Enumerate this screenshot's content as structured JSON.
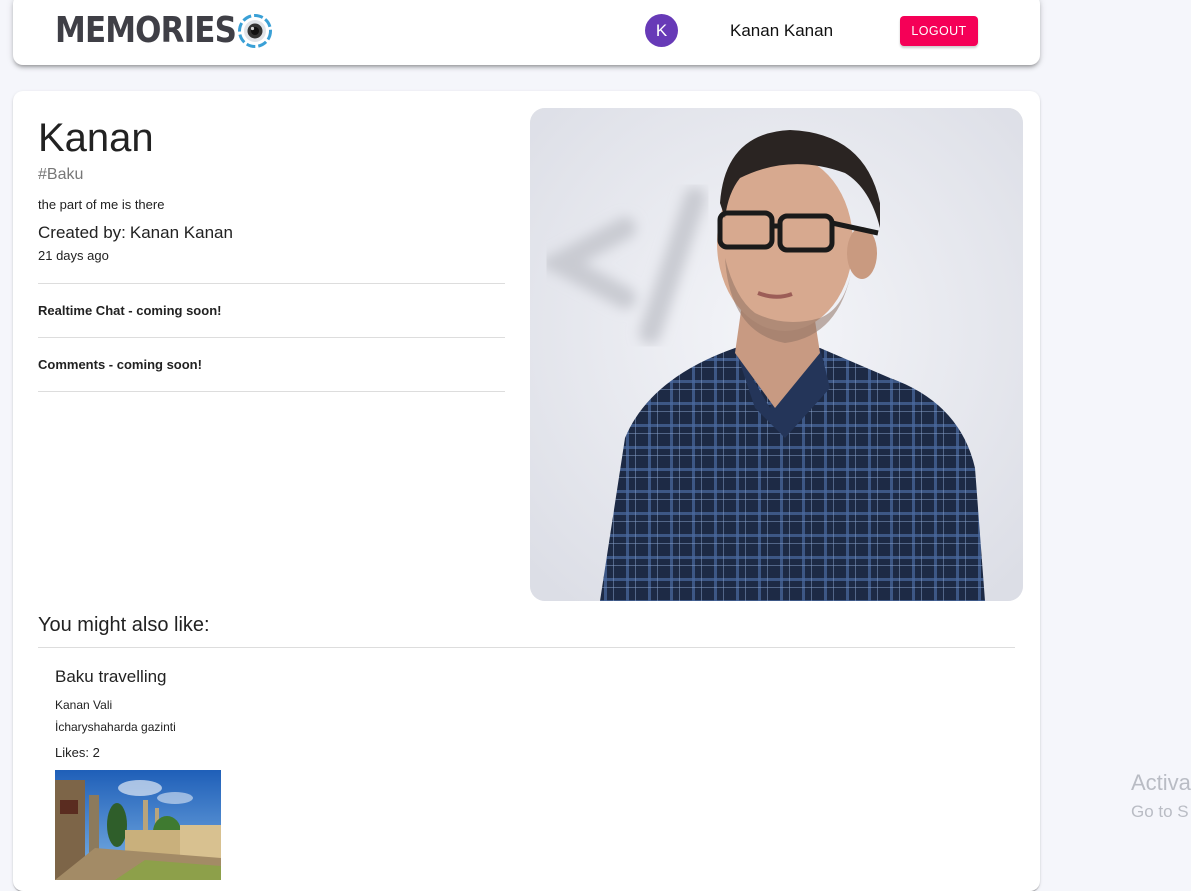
{
  "appbar": {
    "brand": "MEMORIES",
    "avatar_initial": "K",
    "user_name": "Kanan Kanan",
    "logout_label": "LOGOUT"
  },
  "post": {
    "title": "Kanan",
    "tags": "#Baku",
    "message": "the part of me is there",
    "created_by_label": "Created by:",
    "created_by_name": "Kanan Kanan",
    "time_ago": "21 days ago",
    "realtime_chat": "Realtime Chat - coming soon!",
    "comments": "Comments - coming soon!"
  },
  "recommended": {
    "heading": "You might also like:",
    "items": [
      {
        "title": "Baku travelling",
        "author": "Kanan Vali",
        "message": "İcharyshaharda gazinti",
        "likes": "Likes: 2"
      }
    ]
  },
  "watermark": {
    "line1": "Activa",
    "line2": "Go to S"
  },
  "colors": {
    "accent": "#f50057",
    "avatar": "#673ab7",
    "background": "#f5f6fb"
  }
}
